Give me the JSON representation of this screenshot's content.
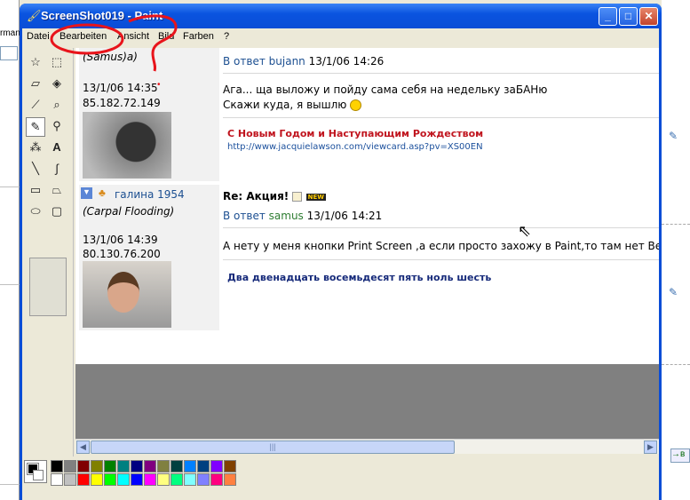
{
  "window": {
    "title": "ScreenShot019 - Paint",
    "controls": {
      "minimize": "_",
      "maximize": "□",
      "close": "✕"
    }
  },
  "menu": [
    "Datei",
    "Bearbeiten",
    "Ansicht",
    "Bild",
    "Farben",
    "?"
  ],
  "background_fragments": {
    "left_top": "rman",
    "right_button": "→в"
  },
  "posts": [
    {
      "author_line": "(Samus)a)",
      "time": "13/1/06 14:35",
      "ip": "85.182.72.149",
      "reply_to_prefix": "В ответ",
      "reply_to_user": "bujann",
      "reply_time": "13/1/06 14:26",
      "body_line1": "Ага... ща выложу и пойду сама себя на недельку заБАНю",
      "body_line2": "Скажи куда, я вышлю",
      "signature_title": "С Новым Годом и Наступающим Рождеством",
      "signature_link": "http://www.jacquielawson.com/viewcard.asp?pv=XS00EN"
    },
    {
      "author": "галина 1954",
      "rank": "(Carpal Flooding)",
      "time": "13/1/06 14:39",
      "ip": "80.130.76.200",
      "subject": "Re: Акция!",
      "badge": "NEW",
      "reply_to_prefix": "В ответ",
      "reply_to_user": "samus",
      "reply_time": "13/1/06 14:21",
      "body_line1": "А нету у меня кнопки Print Screen ,а если просто захожу в Paint,то там нет Bearbe",
      "signature": "Два двенадцать восемьдесят пять ноль шесть"
    }
  ],
  "tools": [
    "free-select",
    "rect-select",
    "eraser",
    "fill",
    "color-picker",
    "magnifier",
    "pencil",
    "brush",
    "airbrush",
    "text",
    "line",
    "curve",
    "rectangle",
    "polygon",
    "ellipse",
    "rounded-rectangle"
  ],
  "palette_colors": [
    "#000000",
    "#808080",
    "#800000",
    "#808000",
    "#008000",
    "#008080",
    "#000080",
    "#800080",
    "#808040",
    "#004040",
    "#0080ff",
    "#004080",
    "#8000ff",
    "#804000",
    "#ffffff",
    "#c0c0c0",
    "#ff0000",
    "#ffff00",
    "#00ff00",
    "#00ffff",
    "#0000ff",
    "#ff00ff",
    "#ffff80",
    "#00ff80",
    "#80ffff",
    "#8080ff",
    "#ff0080",
    "#ff8040"
  ],
  "colors": {
    "annotation": "#e8141b",
    "title_bar": "#0a4dd6"
  }
}
